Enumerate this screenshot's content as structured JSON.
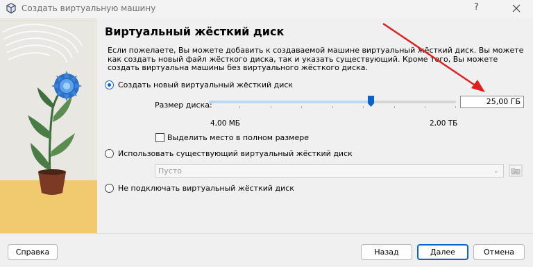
{
  "window": {
    "title": "Создать виртуальную машину",
    "help_glyph": "?",
    "close_label": "Close"
  },
  "page": {
    "heading": "Виртуальный жёсткий диск",
    "description_lines": [
      "Если пожелаете, Вы можете добавить к создаваемой машине виртуальный жёсткий диск. Вы можете",
      "как создать новый файл жёсткого диска, так и указать существующий. Кроме того, Вы можете",
      "создать виртуальна машины без виртуального жёсткого диска."
    ]
  },
  "options": {
    "create_new": {
      "label": "Создать новый виртуальный жёсткий диск",
      "checked": true
    },
    "use_existing": {
      "label": "Использовать существующий виртуальный жёсткий диск",
      "checked": false
    },
    "no_disk": {
      "label": "Не подключать виртуальный жёсткий диск",
      "checked": false
    }
  },
  "disk_size": {
    "label": "Размер диска:",
    "value": "25,00 ГБ",
    "min_label": "4,00 МБ",
    "max_label": "2,00 ТБ",
    "slider_fraction": 0.654
  },
  "preallocate": {
    "label": "Выделить место в полном размере",
    "checked": false
  },
  "existing_disk_combo": {
    "value": "Пусто"
  },
  "buttons": {
    "help": "Справка",
    "back": "Назад",
    "next": "Далее",
    "cancel": "Отмена"
  },
  "icons": {
    "app": "virtualbox-icon",
    "folder": "folder-icon",
    "annotation": "red-arrow"
  },
  "colors": {
    "accent": "#0a64c8",
    "annotation": "#e02020"
  }
}
